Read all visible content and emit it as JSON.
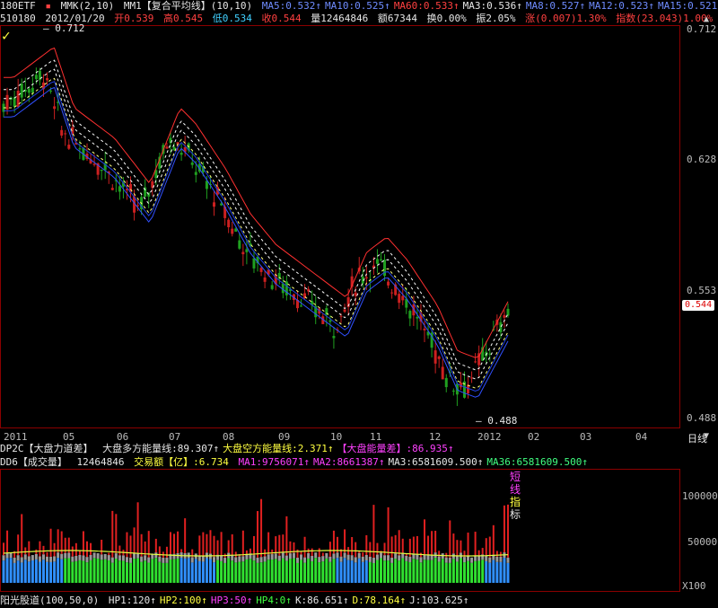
{
  "header": {
    "symbol": "180ETF",
    "indicator_name": "MMK(2,10)",
    "indicator_sub": "MM1【复合平均线】(10,10)",
    "ma": [
      {
        "label": "MA5:0.532",
        "color": "#6f8cff"
      },
      {
        "label": "MA10:0.525",
        "color": "#6f8cff"
      },
      {
        "label": "MA60:0.533",
        "color": "#ff4040"
      },
      {
        "label": "MA3:0.536",
        "color": "#e6e6e6"
      },
      {
        "label": "MA8:0.527",
        "color": "#6f8cff"
      },
      {
        "label": "MA12:0.523",
        "color": "#6f8cff"
      },
      {
        "label": "MA15:0.521",
        "color": "#6f8cff"
      }
    ],
    "quote": {
      "code": "510180",
      "date": "2012/01/20",
      "open": "开0.539",
      "high": "高0.545",
      "low": "低0.534",
      "close": "收0.544",
      "volume": "量12464846",
      "amount": "额67344",
      "turnover": "换0.00%",
      "amplitude": "振2.05%",
      "change": "涨(0.007)1.30%",
      "index_info": "指数(23.043)1.00%"
    }
  },
  "price_panel": {
    "right_axis": [
      "0.712",
      "0.628",
      "0.553",
      "0.488"
    ],
    "current_price_tag": "0.544",
    "high_marker": "0.712",
    "low_marker": "0.488",
    "x_labels": [
      "2011",
      "05",
      "06",
      "07",
      "08",
      "09",
      "10",
      "11",
      "12",
      "2012",
      "02",
      "03",
      "04"
    ],
    "period_label": "日线",
    "bullish_color": "#cc2020",
    "bearish_color": "#20a020"
  },
  "dp_panel": {
    "title": "DP2C【大盘力道差】",
    "items": [
      {
        "label": "大盘多方能量线:89.307",
        "color": "#e6e6e6"
      },
      {
        "label": "大盘空方能量线:2.371",
        "color": "#ffff40"
      },
      {
        "label": "【大盘能量差】:86.935",
        "color": "#ff40ff"
      }
    ]
  },
  "volume_panel": {
    "title": "DD6【成交量】",
    "volume": "12464846",
    "amount": "交易额【亿】:6.734",
    "ma_items": [
      {
        "label": "MA1:9756071",
        "color": "#ff40ff"
      },
      {
        "label": "MA2:8661387",
        "color": "#ff40ff"
      },
      {
        "label": "MA3:6581609.500",
        "color": "#e6e6e6"
      },
      {
        "label": "MA36:6581609.500",
        "color": "#40ff80"
      }
    ],
    "right_axis": [
      "100000",
      "50000"
    ],
    "unit": "X100",
    "vertical_label": [
      "短",
      "线",
      "指",
      "标"
    ]
  },
  "bottom": {
    "title": "阳光股道(100,50,0)",
    "items": [
      {
        "label": "HP1:120",
        "color": "#e6e6e6"
      },
      {
        "label": "HP2:100",
        "color": "#ffff40"
      },
      {
        "label": "HP3:50",
        "color": "#ff40ff"
      },
      {
        "label": "HP4:0",
        "color": "#40ff40"
      },
      {
        "label": "K:86.651",
        "color": "#e6e6e6"
      },
      {
        "label": "D:78.164",
        "color": "#ffff40"
      },
      {
        "label": "J:103.625",
        "color": "#e6e6e6"
      }
    ]
  }
}
